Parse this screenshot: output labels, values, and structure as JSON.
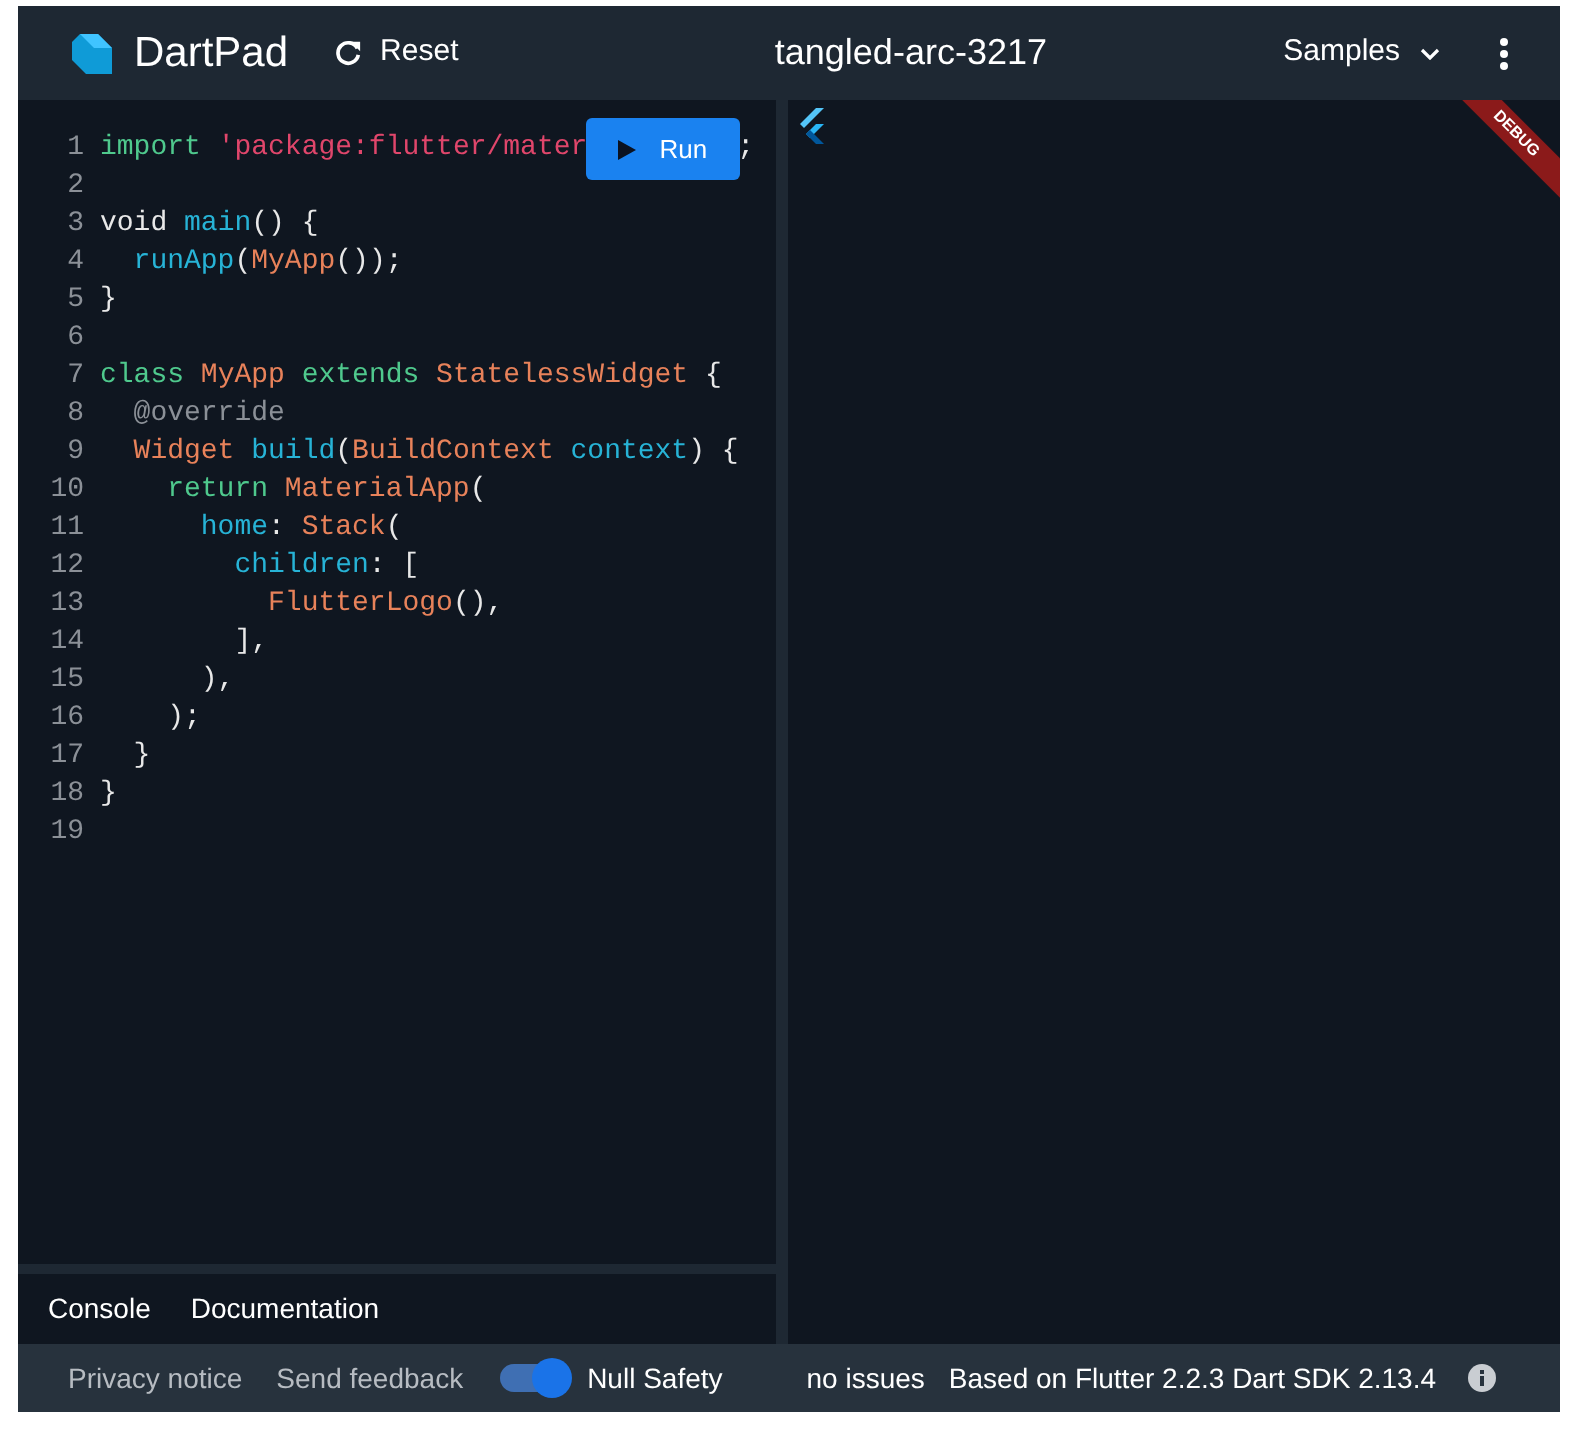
{
  "header": {
    "app_name": "DartPad",
    "reset_label": "Reset",
    "title": "tangled-arc-3217",
    "samples_label": "Samples"
  },
  "editor": {
    "run_button": {
      "label": "Run"
    },
    "lines": [
      {
        "number": "1",
        "tokens": [
          {
            "text": "import",
            "kind": "keyword"
          },
          {
            "text": " 'package:flutter/mater",
            "kind": "string"
          }
        ],
        "tail": ";"
      },
      {
        "number": "2"
      },
      {
        "number": "3",
        "tokens": [
          {
            "text": "void",
            "kind": "plain"
          },
          {
            "text": " main",
            "kind": "function"
          },
          {
            "text": "() {",
            "kind": "plain"
          }
        ]
      },
      {
        "number": "4",
        "tokens": [
          {
            "text": "  runApp",
            "kind": "function"
          },
          {
            "text": "(",
            "kind": "plain"
          },
          {
            "text": "MyApp",
            "kind": "type"
          },
          {
            "text": "());",
            "kind": "plain"
          }
        ]
      },
      {
        "number": "5",
        "tokens": [
          {
            "text": "}",
            "kind": "plain"
          }
        ]
      },
      {
        "number": "6"
      },
      {
        "number": "7",
        "tokens": [
          {
            "text": "class",
            "kind": "keyword"
          },
          {
            "text": " MyApp",
            "kind": "type"
          },
          {
            "text": " extends",
            "kind": "keyword"
          },
          {
            "text": " StatelessWidget",
            "kind": "type"
          },
          {
            "text": " {",
            "kind": "plain"
          }
        ]
      },
      {
        "number": "8",
        "tokens": [
          {
            "text": "  @override",
            "kind": "annotation"
          }
        ]
      },
      {
        "number": "9",
        "tokens": [
          {
            "text": "  Widget",
            "kind": "type"
          },
          {
            "text": " build",
            "kind": "function"
          },
          {
            "text": "(",
            "kind": "plain"
          },
          {
            "text": "BuildContext",
            "kind": "type"
          },
          {
            "text": " context",
            "kind": "function"
          },
          {
            "text": ") {",
            "kind": "plain"
          }
        ]
      },
      {
        "number": "10",
        "tokens": [
          {
            "text": "    return",
            "kind": "keyword"
          },
          {
            "text": " MaterialApp",
            "kind": "type"
          },
          {
            "text": "(",
            "kind": "plain"
          }
        ]
      },
      {
        "number": "11",
        "tokens": [
          {
            "text": "      home",
            "kind": "function"
          },
          {
            "text": ": ",
            "kind": "plain"
          },
          {
            "text": "Stack",
            "kind": "type"
          },
          {
            "text": "(",
            "kind": "plain"
          }
        ]
      },
      {
        "number": "12",
        "tokens": [
          {
            "text": "        children",
            "kind": "function"
          },
          {
            "text": ": [",
            "kind": "plain"
          }
        ]
      },
      {
        "number": "13",
        "tokens": [
          {
            "text": "          FlutterLogo",
            "kind": "type"
          },
          {
            "text": "(),",
            "kind": "plain"
          }
        ]
      },
      {
        "number": "14",
        "tokens": [
          {
            "text": "        ],",
            "kind": "plain"
          }
        ]
      },
      {
        "number": "15",
        "tokens": [
          {
            "text": "      ),",
            "kind": "plain"
          }
        ]
      },
      {
        "number": "16",
        "tokens": [
          {
            "text": "    );",
            "kind": "plain"
          }
        ]
      },
      {
        "number": "17",
        "tokens": [
          {
            "text": "  }",
            "kind": "plain"
          }
        ]
      },
      {
        "number": "18",
        "tokens": [
          {
            "text": "}",
            "kind": "plain"
          }
        ]
      },
      {
        "number": "19"
      }
    ]
  },
  "console_tabs": [
    {
      "label": "Console"
    },
    {
      "label": "Documentation"
    }
  ],
  "preview": {
    "debug_banner": "DEBUG"
  },
  "status_bar": {
    "privacy": "Privacy notice",
    "feedback": "Send feedback",
    "null_safety": {
      "label": "Null Safety",
      "on": true
    },
    "issues": "no issues",
    "version": "Based on Flutter 2.2.3 Dart SDK 2.13.4"
  }
}
